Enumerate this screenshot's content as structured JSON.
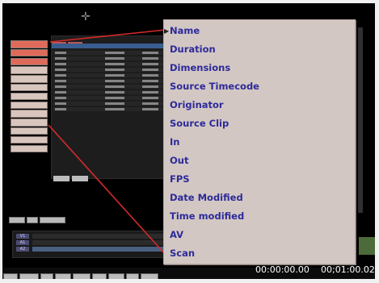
{
  "popup_menu": {
    "items": [
      "Name",
      "Duration",
      "Dimensions",
      "Source Timecode",
      "Originator",
      "Source Clip",
      "In",
      "Out",
      "FPS",
      "Date Modified",
      "Time modified",
      "AV",
      "Scan"
    ]
  },
  "timecodes": {
    "current": "00:00:00.00",
    "duration": "00;01:00.02"
  },
  "tracks": [
    "V1",
    "A1",
    "A2"
  ],
  "colors": {
    "menu_bg": "#d3c7c3",
    "menu_text": "#2c2a9a",
    "leader": "#d42a2a",
    "screen_bg": "#000000"
  }
}
